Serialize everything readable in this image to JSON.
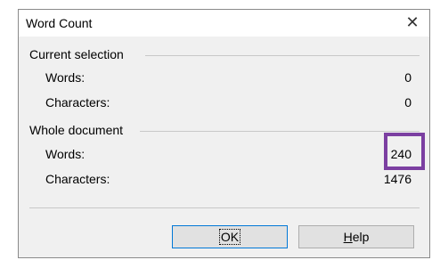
{
  "dialog": {
    "title": "Word Count",
    "close_glyph": "✕",
    "current_selection": {
      "heading": "Current selection",
      "words_label": "Words:",
      "words_value": "0",
      "characters_label": "Characters:",
      "characters_value": "0"
    },
    "whole_document": {
      "heading": "Whole document",
      "words_label": "Words:",
      "words_value": "240",
      "characters_label": "Characters:",
      "characters_value": "1476"
    },
    "buttons": {
      "ok_label": "OK",
      "help_first_letter": "H",
      "help_rest": "elp"
    }
  },
  "colors": {
    "highlight": "#7b3fa1",
    "dialog_bg": "#f0f0f0",
    "titlebar_bg": "#ffffff",
    "ok_border": "#0078d7"
  }
}
